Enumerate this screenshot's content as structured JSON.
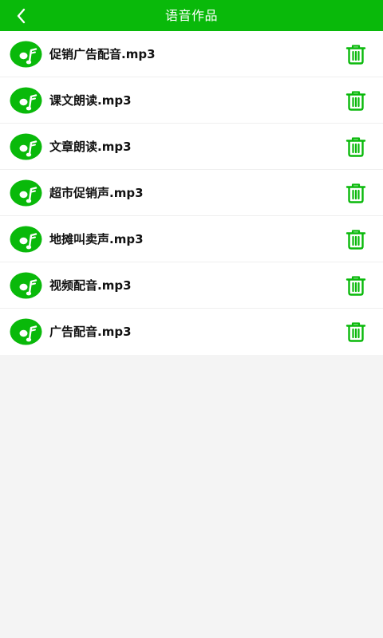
{
  "header": {
    "title": "语音作品",
    "back_icon": "chevron-left-icon"
  },
  "colors": {
    "accent": "#09b90a",
    "background": "#f4f4f4",
    "list_background": "#ffffff"
  },
  "items": [
    {
      "name": "促销广告配音.mp3",
      "icon": "music-disc-icon",
      "action_icon": "trash-icon"
    },
    {
      "name": "课文朗读.mp3",
      "icon": "music-disc-icon",
      "action_icon": "trash-icon"
    },
    {
      "name": "文章朗读.mp3",
      "icon": "music-disc-icon",
      "action_icon": "trash-icon"
    },
    {
      "name": "超市促销声.mp3",
      "icon": "music-disc-icon",
      "action_icon": "trash-icon"
    },
    {
      "name": "地摊叫卖声.mp3",
      "icon": "music-disc-icon",
      "action_icon": "trash-icon"
    },
    {
      "name": "视频配音.mp3",
      "icon": "music-disc-icon",
      "action_icon": "trash-icon"
    },
    {
      "name": "广告配音.mp3",
      "icon": "music-disc-icon",
      "action_icon": "trash-icon"
    }
  ]
}
